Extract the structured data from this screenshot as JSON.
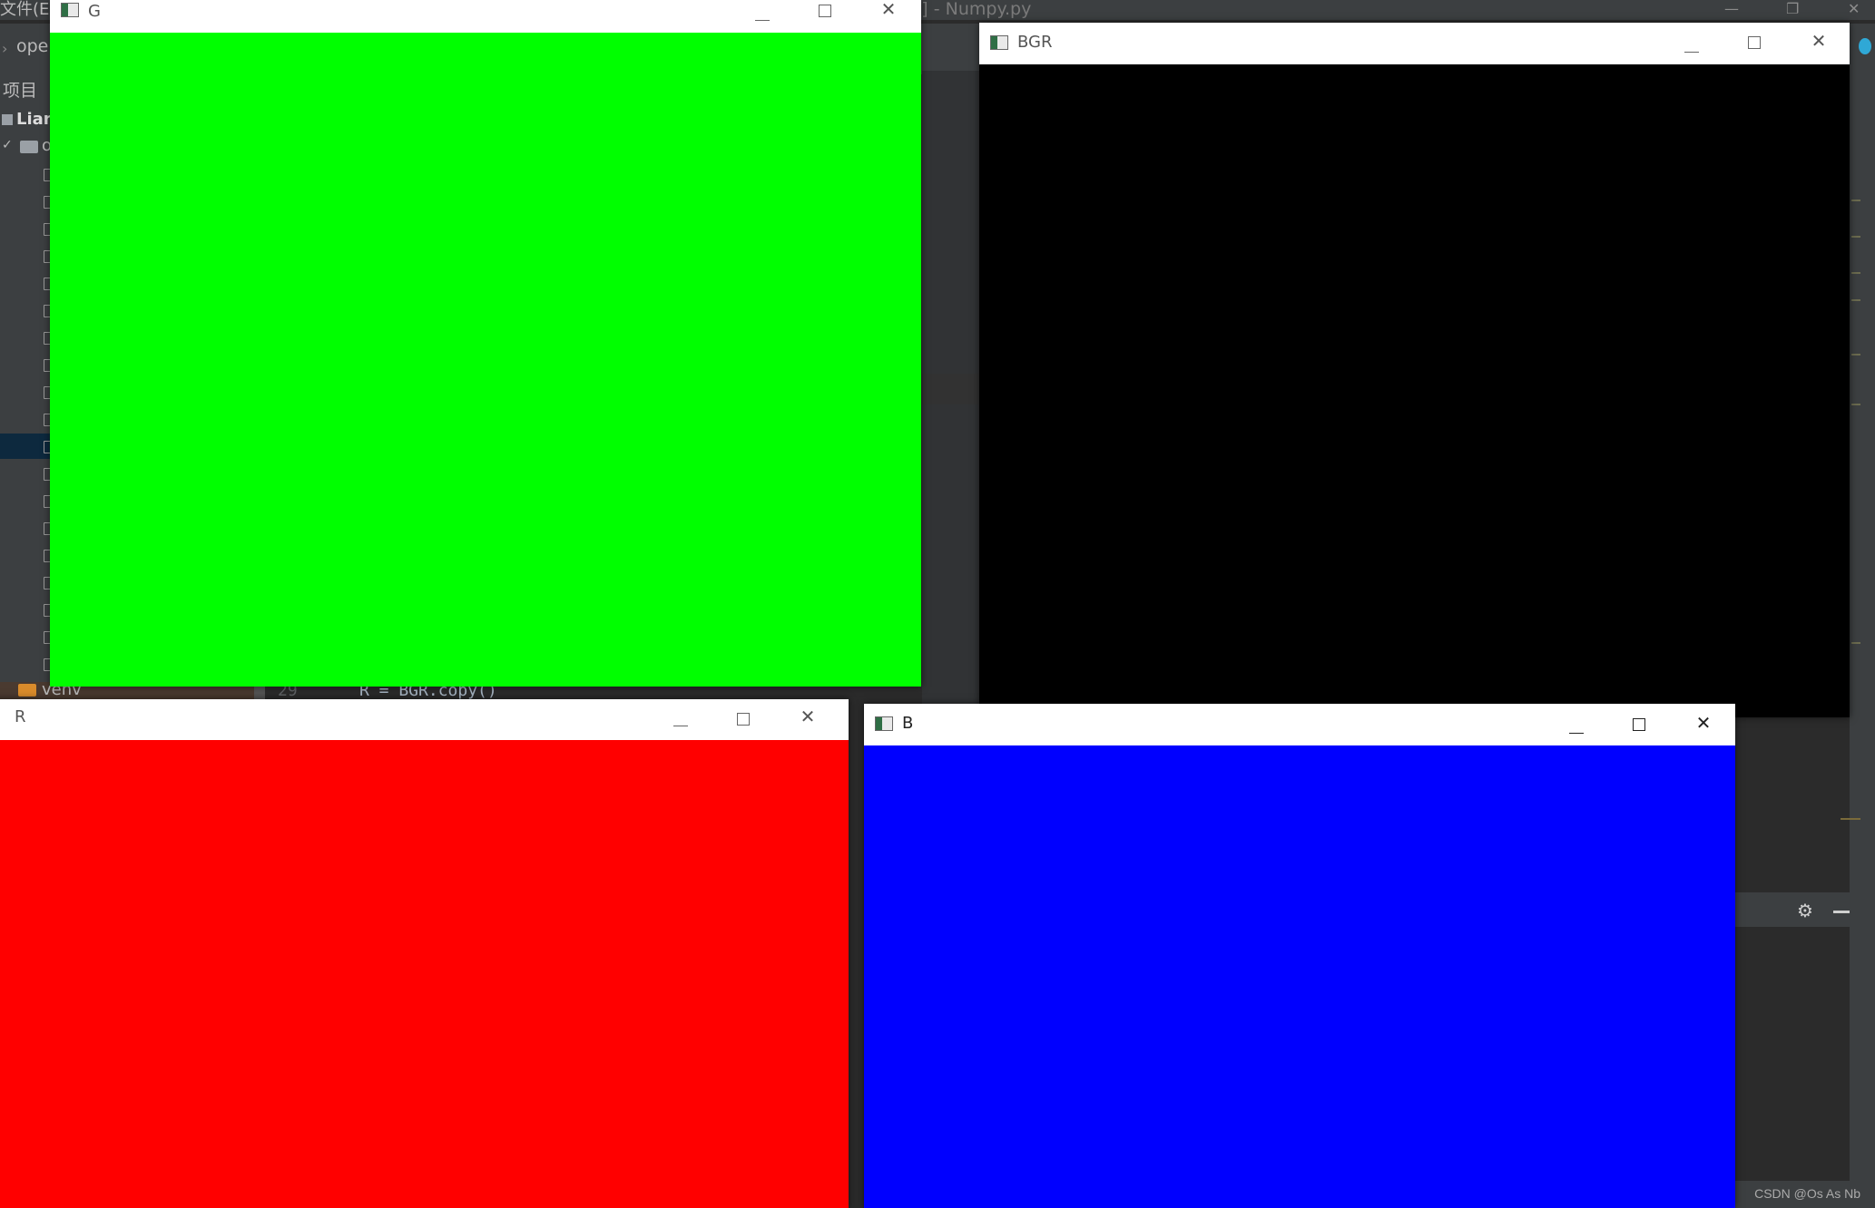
{
  "ide": {
    "menu_file": "文件(E)",
    "title": "i] - Numpy.py",
    "breadcrumb": "oper",
    "project_label": "项目",
    "tree_root": "Lian",
    "tree_folder": "o",
    "venv_label": "venv",
    "line_number": "29",
    "code_line": "R = BGR.copy()"
  },
  "windows": {
    "g": {
      "title": "G",
      "fill": "#00ff00"
    },
    "bgr": {
      "title": "BGR",
      "fill": "#000000"
    },
    "r": {
      "title": "R",
      "fill": "#ff0000"
    },
    "b": {
      "title": "B",
      "fill": "#0000ff"
    }
  },
  "icons": {
    "window": "window-icon",
    "minimize": "minimize-icon",
    "maximize": "maximize-icon",
    "close": "close-icon",
    "gear": "gear-icon",
    "minus": "minus-icon"
  },
  "watermark": "CSDN @Os As Nb"
}
